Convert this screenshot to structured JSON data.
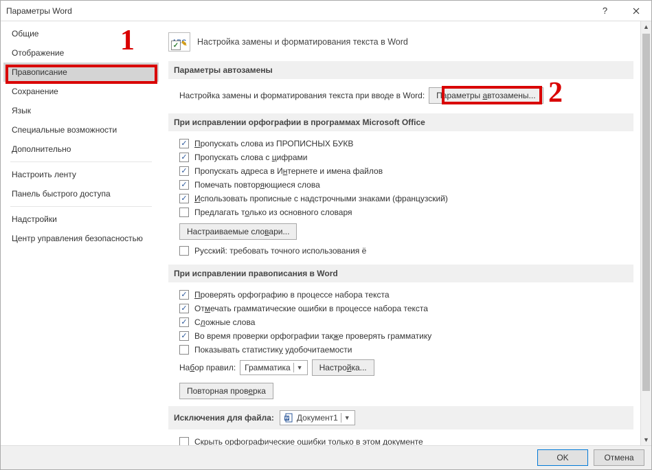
{
  "window": {
    "title": "Параметры Word"
  },
  "sidebar": {
    "groups": [
      [
        "Общие",
        "Отображение",
        "Правописание",
        "Сохранение",
        "Язык",
        "Специальные возможности",
        "Дополнительно"
      ],
      [
        "Настроить ленту",
        "Панель быстрого доступа"
      ],
      [
        "Надстройки",
        "Центр управления безопасностью"
      ]
    ],
    "selected": "Правописание"
  },
  "header": {
    "text": "Настройка замены и форматирования текста в Word"
  },
  "section_autocorrect": {
    "title": "Параметры автозамены",
    "desc": "Настройка замены и форматирования текста при вводе в Word:",
    "button": "Параметры автозамены..."
  },
  "section_spell_office": {
    "title": "При исправлении орфографии в программах Microsoft Office",
    "checks": [
      {
        "label": "Пропускать слова из ПРОПИСНЫХ БУКВ",
        "checked": true
      },
      {
        "label": "Пропускать слова с цифрами",
        "checked": true
      },
      {
        "label": "Пропускать адреса в Интернете и имена файлов",
        "checked": true
      },
      {
        "label": "Помечать повторяющиеся слова",
        "checked": true
      },
      {
        "label": "Использовать прописные с надстрочными знаками (французский)",
        "checked": true
      },
      {
        "label": "Предлагать только из основного словаря",
        "checked": false
      }
    ],
    "dict_button": "Настраиваемые словари...",
    "russian": {
      "label": "Русский: требовать точного использования ё",
      "checked": false
    }
  },
  "section_spell_word": {
    "title": "При исправлении правописания в Word",
    "checks": [
      {
        "label": "Проверять орфографию в процессе набора текста",
        "checked": true
      },
      {
        "label": "Отмечать грамматические ошибки в процессе набора текста",
        "checked": true
      },
      {
        "label": "Сложные слова",
        "checked": true
      },
      {
        "label": "Во время проверки орфографии также проверять грамматику",
        "checked": true
      },
      {
        "label": "Показывать статистику удобочитаемости",
        "checked": false
      }
    ],
    "ruleset_label": "Набор правил:",
    "ruleset_value": "Грамматика",
    "settings_button": "Настройка...",
    "recheck_button": "Повторная проверка"
  },
  "section_exceptions": {
    "title": "Исключения для файла:",
    "file_value": "Документ1",
    "checks": [
      {
        "label": "Скрыть орфографические ошибки только в этом документе",
        "checked": false
      }
    ]
  },
  "footer": {
    "ok": "OK",
    "cancel": "Отмена"
  },
  "annot": {
    "one": "1",
    "two": "2"
  }
}
